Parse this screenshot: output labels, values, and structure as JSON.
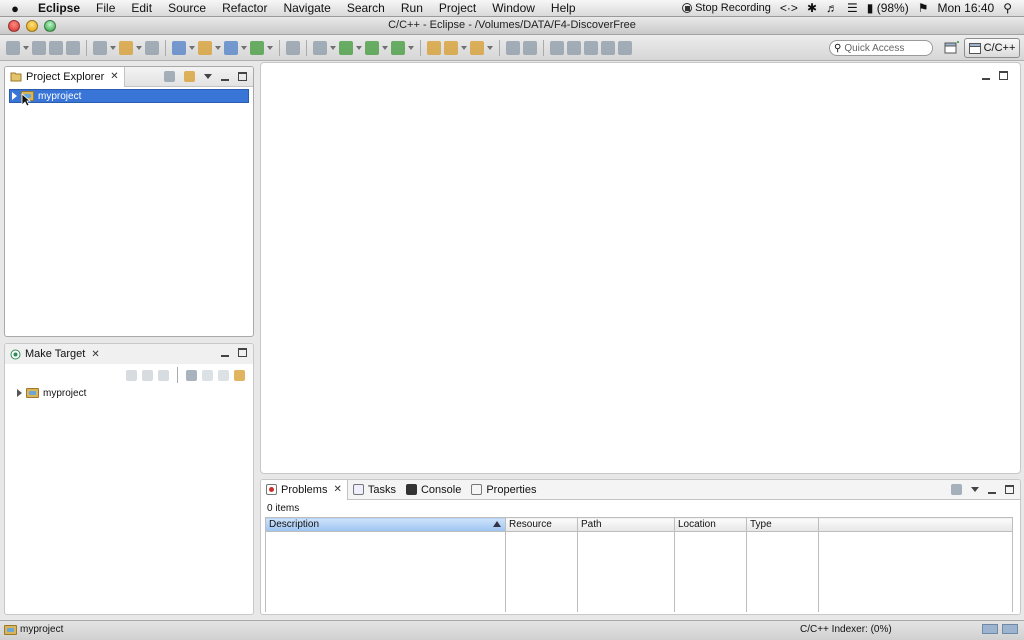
{
  "menubar": {
    "app": "Eclipse",
    "items": [
      "File",
      "Edit",
      "Source",
      "Refactor",
      "Navigate",
      "Search",
      "Run",
      "Project",
      "Window",
      "Help"
    ],
    "recording": "Stop Recording",
    "battery": "(98%)",
    "clock": "Mon 16:40"
  },
  "window": {
    "title": "C/C++ - Eclipse - /Volumes/DATA/F4-DiscoverFree"
  },
  "toolbar": {
    "quick_access_placeholder": "Quick Access",
    "perspective": "C/C++"
  },
  "project_explorer": {
    "tab": "Project Explorer",
    "items": [
      {
        "label": "myproject"
      }
    ]
  },
  "make_target": {
    "tab": "Make Target",
    "items": [
      {
        "label": "myproject"
      }
    ]
  },
  "bottom_panel": {
    "tabs": [
      "Problems",
      "Tasks",
      "Console",
      "Properties"
    ],
    "count": "0 items",
    "columns": [
      "Description",
      "Resource",
      "Path",
      "Location",
      "Type"
    ]
  },
  "status": {
    "selected": "myproject",
    "indexer": "C/C++ Indexer: (0%)"
  },
  "colors": {
    "selection": "#3875d7",
    "editor_bg": "#ffffff"
  }
}
